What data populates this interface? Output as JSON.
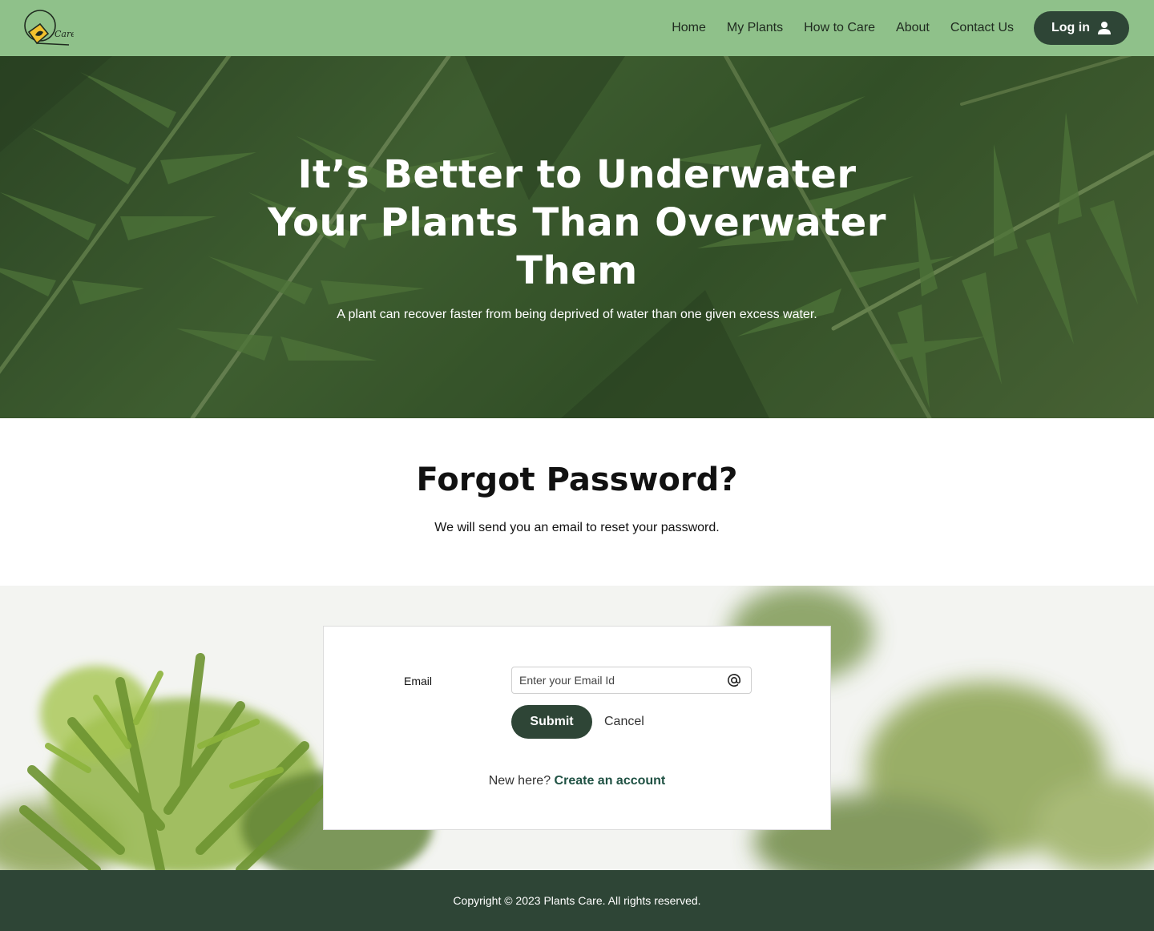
{
  "header": {
    "logo_text": "Care",
    "nav": [
      "Home",
      "My Plants",
      "How to Care",
      "About",
      "Contact Us"
    ],
    "login_label": "Log in"
  },
  "hero": {
    "title": "It’s Better to Underwater Your Plants Than Overwater Them",
    "subtitle": "A plant can recover faster from being deprived of water than one given excess water."
  },
  "forgot": {
    "title": "Forgot Password?",
    "subtitle": "We will send you an email to reset your password."
  },
  "form": {
    "email_label": "Email",
    "email_placeholder": "Enter your Email Id",
    "email_value": "",
    "submit_label": "Submit",
    "cancel_label": "Cancel",
    "new_here": "New here?",
    "create_account": "Create an account"
  },
  "footer": {
    "copyright": "Copyright © 2023 Plants Care. All rights reserved."
  },
  "colors": {
    "header_bg": "#8fc18a",
    "primary_dark": "#2e4536",
    "link_green": "#1f5143"
  }
}
